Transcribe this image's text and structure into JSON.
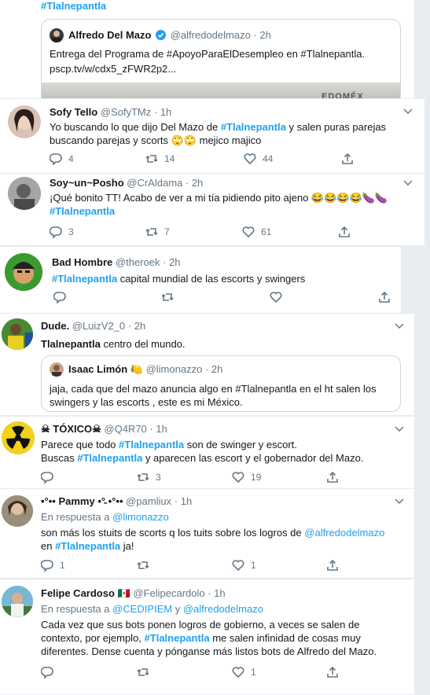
{
  "top": {
    "hashtag": "#Tlalnepantla",
    "quote": {
      "name": "Alfredo Del Mazo",
      "handle": "@alfredodelmazo",
      "time": "· 2h",
      "text_line1": "Entrega del Programa de #ApoyoParaElDesempleo en #Tlalnepantla.",
      "text_line2": "pscp.tv/w/cdx5_zFWR2p2...",
      "image_text": "EDOMÉX"
    }
  },
  "tweets": [
    {
      "name": "Sofy Tello",
      "handle": "@SofyTMz",
      "time": "· 1h",
      "text": {
        "a": "Yo buscando lo que dijo Del Mazo de ",
        "tag": "#Tlalnepantla",
        "b": " y salen puras parejas",
        "line2": "buscando parejas y scorts 🙄🙄 mejico majico"
      },
      "replies": "4",
      "retweets": "14",
      "likes": "44"
    },
    {
      "name": "Soy~un~Posho",
      "handle": "@CrAldama",
      "time": "· 2h",
      "text": {
        "line1": "¡Qué bonito TT! Acabo de ver a mi tía pidiendo pito ajeno 😂😂😂😂🍆🍆",
        "tag": "#Tlalnepantla"
      },
      "replies": "3",
      "retweets": "7",
      "likes": "61"
    },
    {
      "name": "Bad Hombre",
      "handle": "@theroek",
      "time": "· 2h",
      "text": {
        "tag": "#Tlalnepantla",
        "rest": " capital mundial de las  escorts y swingers"
      }
    },
    {
      "name": "Dude.",
      "handle": "@LuizV2_0",
      "time": "· 2h",
      "text": {
        "bold": "Tlalnepantla",
        "rest": " centro del mundo."
      },
      "quote": {
        "name": "Isaac Limón",
        "emoji": "🍋",
        "handle": "@limonazzo",
        "time": "· 2h",
        "line1": "jaja, cada que del mazo anuncia algo en #Tlalnepantla en el ht salen los",
        "line2": "swingers y las escorts , este es mi México."
      }
    },
    {
      "name": "☠ TÓXICO☠",
      "handle": "@Q4R70",
      "time": "· 1h",
      "text": {
        "a": "Parece que todo ",
        "tag": "#Tlalnepantla",
        "b": " son de swinger y escort.",
        "c": "Buscas ",
        "tag2": "#Tlalnepantla",
        "d": " y aparecen las escort y el gobernador del Mazo."
      },
      "retweets": "3",
      "likes": "19"
    },
    {
      "name": "•°•• Pammy •°̵ •°••",
      "handle": "@pamliux",
      "time": "· 1h",
      "reply_prefix": "En respuesta a ",
      "reply_to": "@limonazzo",
      "text": {
        "a": "son más los stuits de scorts q los tuits sobre los logros de ",
        "mention": "@alfredodelmazo",
        "b": "en ",
        "tag": "#Tlalnepantla",
        "c": " ja!"
      },
      "replies": "1",
      "likes": "1"
    },
    {
      "name": "Felipe Cardoso",
      "flag": "🇲🇽",
      "handle": "@Felipecardolo",
      "time": "· 1h",
      "reply_prefix": "En respuesta a ",
      "reply_to1": "@CEDIPIEM",
      "reply_and": " y ",
      "reply_to2": "@alfredodelmazo",
      "text": {
        "line1": "Cada vez que sus bots ponen logros de gobierno, a veces se salen de",
        "line2a": "contexto, por ejemplo, ",
        "tag": "#Tlalnepantla",
        "line2b": " me salen infinidad de cosas muy",
        "line3": "diferentes. Dense cuenta y pónganse más listos bots de Alfredo del Mazo."
      },
      "likes": "1"
    }
  ],
  "colors": {
    "accent": "#1da1f2",
    "muted": "#657786",
    "text": "#14171a",
    "border": "#e6ecf0"
  }
}
